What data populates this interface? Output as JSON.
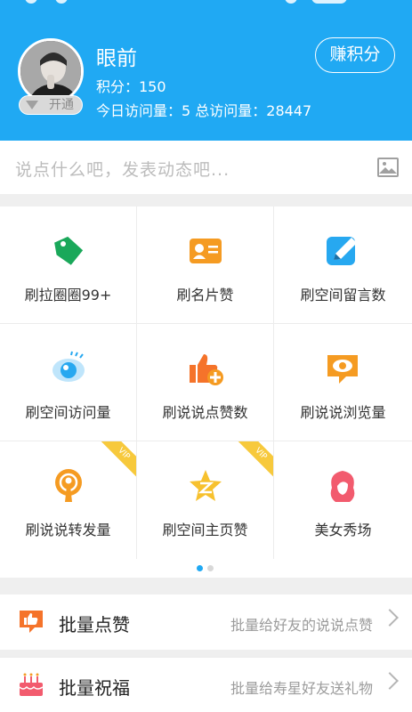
{
  "profile": {
    "name": "眼前",
    "points": "积分：150",
    "visits": "今日访问量：5  总访问量：28447",
    "badge": "开通",
    "earn_button": "赚积分"
  },
  "post": {
    "placeholder": "说点什么吧，发表动态吧..."
  },
  "grid": {
    "items": [
      {
        "label": "刷拉圈圈99+",
        "icon": "tag-icon",
        "color": "#1aa85a"
      },
      {
        "label": "刷名片赞",
        "icon": "name-card-icon",
        "color": "#f59b22"
      },
      {
        "label": "刷空间留言数",
        "icon": "pen-icon",
        "color": "#27a8f0"
      },
      {
        "label": "刷空间访问量",
        "icon": "eye-icon",
        "color": "#27a8f0"
      },
      {
        "label": "刷说说点赞数",
        "icon": "thumbs-up-plus-icon",
        "color": "#f5732a"
      },
      {
        "label": "刷说说浏览量",
        "icon": "eye-bubble-icon",
        "color": "#f59b22"
      },
      {
        "label": "刷说说转发量",
        "icon": "podcast-icon",
        "color": "#f59b22",
        "vip": "VIP"
      },
      {
        "label": "刷空间主页赞",
        "icon": "star-z-icon",
        "color": "#f7c12e",
        "vip": "VIP"
      },
      {
        "label": "美女秀场",
        "icon": "woman-icon",
        "color": "#f25b6e"
      }
    ]
  },
  "list": [
    {
      "title": "批量点赞",
      "desc": "批量给好友的说说点赞",
      "icon": "thumbs-up-bubble-icon"
    },
    {
      "title": "批量祝福",
      "desc": "批量给寿星好友送礼物",
      "icon": "cake-icon"
    }
  ],
  "colors": {
    "header": "#20a9f3",
    "pager_active": "#20a9f3",
    "pager_inactive": "#d8d8d8"
  }
}
